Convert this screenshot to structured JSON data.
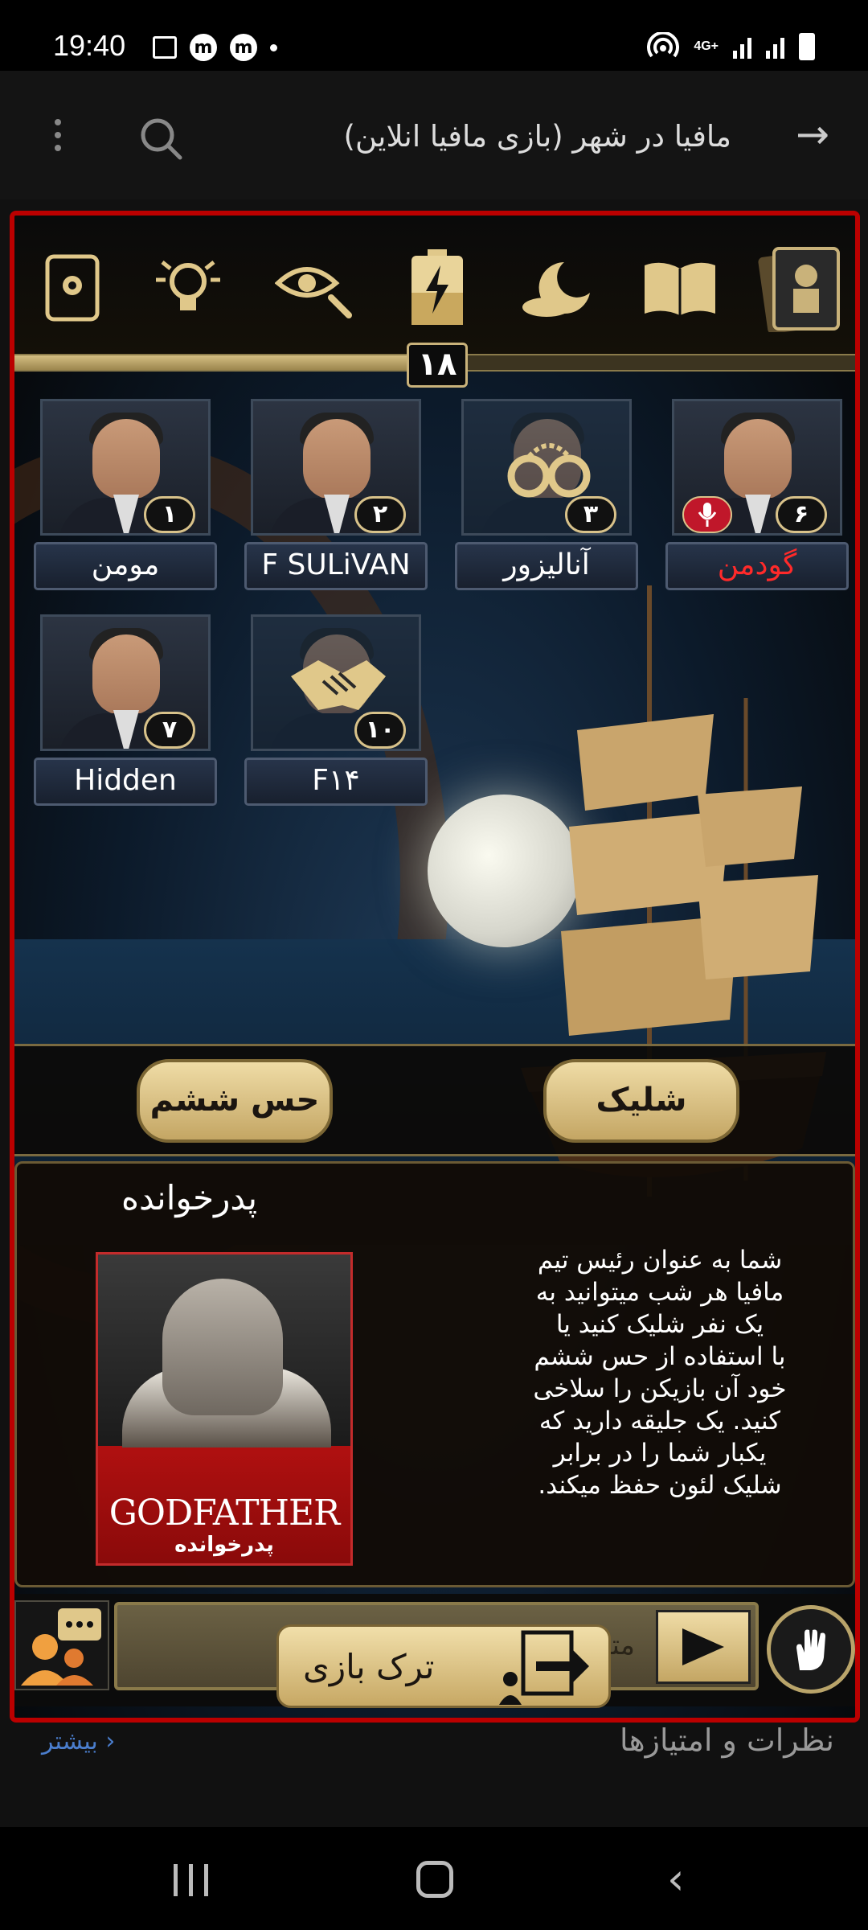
{
  "status_bar": {
    "time": "19:40",
    "network": "4G+",
    "icons": [
      "gallery-icon",
      "m-app-icon",
      "m-app-icon",
      "dot",
      "hotspot-icon",
      "signal-icon",
      "signal-icon",
      "battery-icon"
    ],
    "m_glyph": "m"
  },
  "app_bar": {
    "title": "مافیا در شهر (بازی مافیا انلاین)",
    "back_icon": "arrow-right-icon",
    "search_icon": "search-icon",
    "more_icon": "more-vert-icon"
  },
  "game": {
    "toolbar": [
      "settings-tablet-icon",
      "idea-bulb-icon",
      "eye-icon",
      "battery-bolt-icon",
      "moon-night-icon",
      "book-icon",
      "cards-icon"
    ],
    "timer": "۱۸",
    "progress": 0.49,
    "players": [
      {
        "name": "مومن",
        "number": "۱",
        "avatar": "man-glasses",
        "highlight": false,
        "mic": false
      },
      {
        "name": "F SULiVAN",
        "number": "۲",
        "avatar": "man",
        "highlight": false,
        "mic": false
      },
      {
        "name": "آنالیزور",
        "number": "۳",
        "avatar": "handcuffs-icon",
        "highlight": false,
        "mic": false
      },
      {
        "name": "گودمن",
        "number": "۶",
        "avatar": "man",
        "highlight": true,
        "mic": true
      },
      {
        "name": "Hidden",
        "number": "۷",
        "avatar": "man-glasses",
        "highlight": false,
        "mic": false
      },
      {
        "name": "F۱۴",
        "number": "۱۰",
        "avatar": "handshake-icon",
        "highlight": false,
        "mic": false
      }
    ],
    "actions": {
      "sixth_sense": "حس ششم",
      "shoot": "شلیک"
    },
    "role": {
      "title": "پدرخوانده",
      "card_en": "GODFATHER",
      "card_fa": "پدرخوانده",
      "description_lines": [
        "شما به عنوان رئیس تیم",
        "مافیا هر شب میتوانید به",
        "یک نفر شلیک کنید یا",
        "با استفاده از حس ششم",
        "خود آن بازیکن را سلاخی",
        "کنید. یک جلیقه دارید که",
        "یکبار شما را در برابر",
        "شلیک لئون حفظ میکند."
      ]
    },
    "chat": {
      "placeholder": "متن",
      "leave_label": "ترک بازی"
    }
  },
  "reviews": {
    "title": "نظرات و امتیازها",
    "more": "بیشتر"
  },
  "colors": {
    "frame_red": "#b00000",
    "gold": "#d4be82",
    "highlight_name": "#ff2a2a"
  }
}
